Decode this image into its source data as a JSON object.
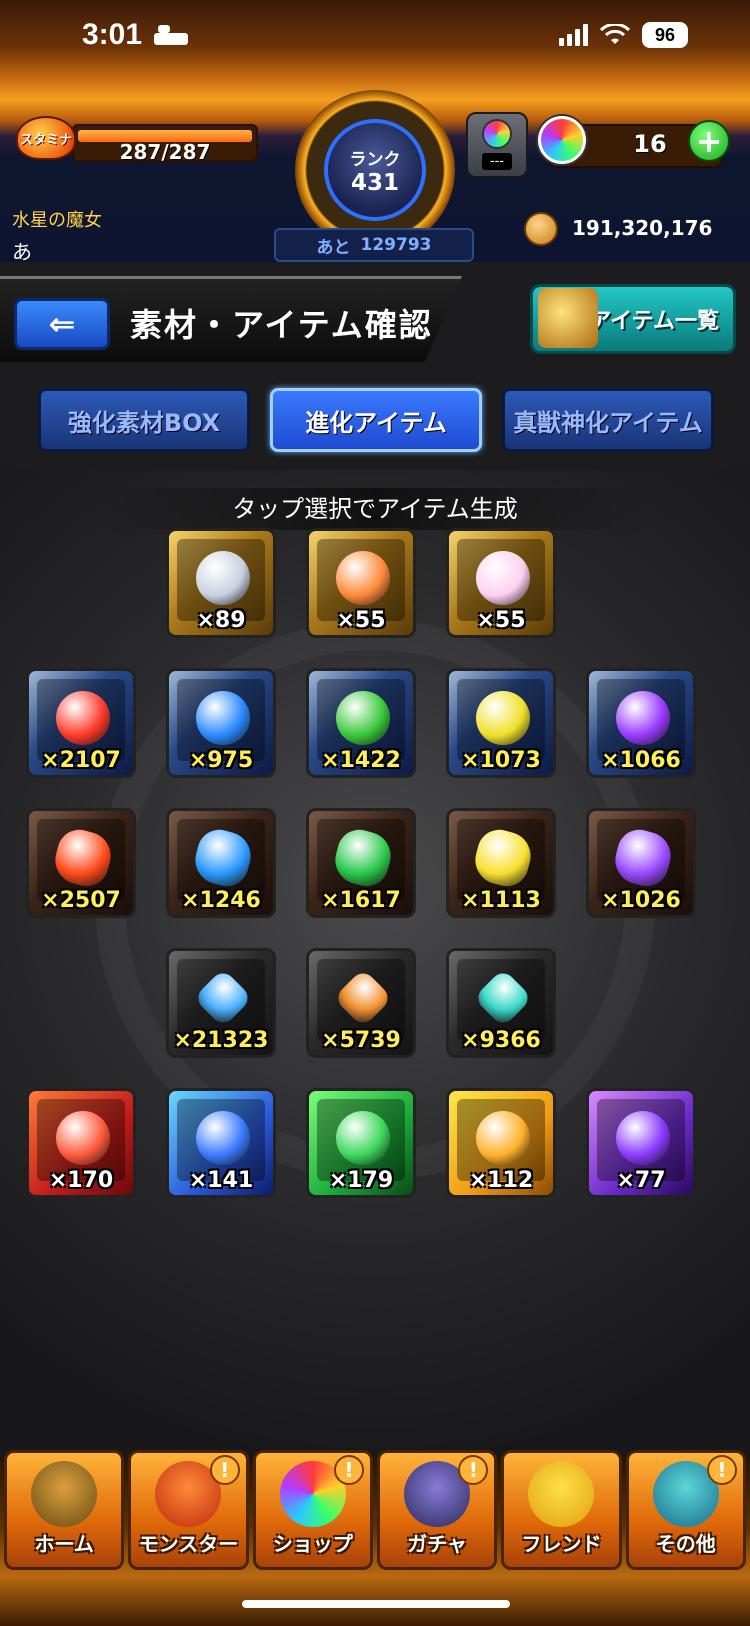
{
  "status_bar": {
    "time": "3:01",
    "battery": "96"
  },
  "player": {
    "stamina_label": "スタミナ",
    "stamina": "287/287",
    "stamina_fraction": 1.0,
    "title": "水星の魔女",
    "name": "あ"
  },
  "rank": {
    "label": "ランク",
    "value": "431",
    "next_prefix": "あと",
    "next_value": "129793"
  },
  "resources": {
    "lock_value": "---",
    "orb_count": "16",
    "coins": "191,320,176"
  },
  "header": {
    "title": "素材・アイテム確認",
    "item_list_button": "アイテム一覧"
  },
  "tabs": [
    {
      "label": "強化素材BOX",
      "active": false
    },
    {
      "label": "進化アイテム",
      "active": true
    },
    {
      "label": "真獣神化アイテム",
      "active": false
    }
  ],
  "instruction": "タップ選択でアイテム生成",
  "items": [
    {
      "count": "×89",
      "frame": "gold",
      "art": "silver-crest",
      "art_color": "#c8d0e0"
    },
    {
      "count": "×55",
      "frame": "gold",
      "art": "rainbow-fruit",
      "art_color": "#ff8a3a"
    },
    {
      "count": "×55",
      "frame": "gold",
      "art": "rainbow-orb",
      "art_color": "#ffd0f0"
    },
    {
      "count": "×2107",
      "frame": "blue",
      "art": "fire-sphere",
      "art_color": "#ff3a2a"
    },
    {
      "count": "×975",
      "frame": "blue",
      "art": "water-sphere",
      "art_color": "#2a8aff"
    },
    {
      "count": "×1422",
      "frame": "blue",
      "art": "wood-sphere",
      "art_color": "#3ac83a"
    },
    {
      "count": "×1073",
      "frame": "blue",
      "art": "light-sphere",
      "art_color": "#f0e02a"
    },
    {
      "count": "×1066",
      "frame": "blue",
      "art": "dark-sphere",
      "art_color": "#9a3aff"
    },
    {
      "count": "×2507",
      "frame": "brown",
      "art": "fire-gem",
      "art_color": "#ff4a1a"
    },
    {
      "count": "×1246",
      "frame": "brown",
      "art": "water-gem",
      "art_color": "#2a9aff"
    },
    {
      "count": "×1617",
      "frame": "brown",
      "art": "wood-gem",
      "art_color": "#2ac84a"
    },
    {
      "count": "×1113",
      "frame": "brown",
      "art": "light-gem",
      "art_color": "#f8e030"
    },
    {
      "count": "×1026",
      "frame": "brown",
      "art": "dark-gem",
      "art_color": "#9a4aff"
    },
    {
      "count": "×21323",
      "frame": "gray",
      "art": "blue-crystal",
      "art_color": "#4ab0ff"
    },
    {
      "count": "×5739",
      "frame": "gray",
      "art": "amber-crystal",
      "art_color": "#f09030"
    },
    {
      "count": "×9366",
      "frame": "gray",
      "art": "teal-crystal",
      "art_color": "#3ad8c8"
    },
    {
      "count": "×170",
      "frame": "red",
      "art": "fire-dragon-egg",
      "art_color": "#ff5a3a"
    },
    {
      "count": "×141",
      "frame": "cyan",
      "art": "water-dragon-egg",
      "art_color": "#3a7aff"
    },
    {
      "count": "×179",
      "frame": "green",
      "art": "wood-dragon-egg",
      "art_color": "#3ad85a"
    },
    {
      "count": "×112",
      "frame": "yellow",
      "art": "light-dragon-egg",
      "art_color": "#ffb02a"
    },
    {
      "count": "×77",
      "frame": "purple",
      "art": "dark-dragon-egg",
      "art_color": "#8a3aff"
    }
  ],
  "nav": [
    {
      "label": "ホーム",
      "icon": "home-gate-icon",
      "alert": false
    },
    {
      "label": "モンスター",
      "icon": "monster-icon",
      "alert": true
    },
    {
      "label": "ショップ",
      "icon": "rainbow-orb-icon",
      "alert": true
    },
    {
      "label": "ガチャ",
      "icon": "gacha-characters-icon",
      "alert": true
    },
    {
      "label": "フレンド",
      "icon": "friends-icon",
      "alert": false
    },
    {
      "label": "その他",
      "icon": "other-menu-icon",
      "alert": true
    }
  ],
  "alert_symbol": "!",
  "colors": {
    "accent_orange": "#f4a020",
    "tab_blue": "#1e4ad0",
    "count_yellow": "#ffee55",
    "item_list_teal": "#22c7c7"
  }
}
